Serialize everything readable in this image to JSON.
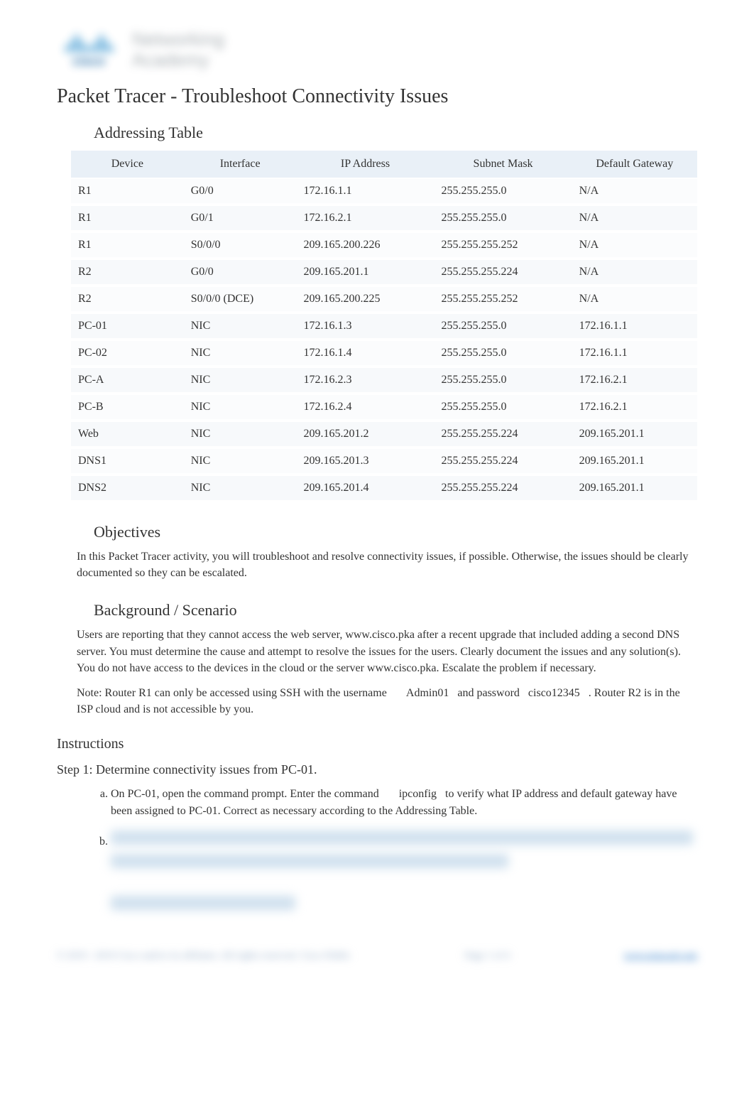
{
  "logo": {
    "brand_top": "Networking",
    "brand_bottom": "Academy",
    "brand_left": "cisco"
  },
  "title": "Packet Tracer - Troubleshoot Connectivity Issues",
  "addressing_heading": "Addressing Table",
  "table": {
    "headers": [
      "Device",
      "Interface",
      "IP Address",
      "Subnet Mask",
      "Default Gateway"
    ],
    "rows": [
      [
        "R1",
        "G0/0",
        "172.16.1.1",
        "255.255.255.0",
        "N/A"
      ],
      [
        "R1",
        "G0/1",
        "172.16.2.1",
        "255.255.255.0",
        "N/A"
      ],
      [
        "R1",
        "S0/0/0",
        "209.165.200.226",
        "255.255.255.252",
        "N/A"
      ],
      [
        "R2",
        "G0/0",
        "209.165.201.1",
        "255.255.255.224",
        "N/A"
      ],
      [
        "R2",
        "S0/0/0 (DCE)",
        "209.165.200.225",
        "255.255.255.252",
        "N/A"
      ],
      [
        "PC-01",
        "NIC",
        "172.16.1.3",
        "255.255.255.0",
        "172.16.1.1"
      ],
      [
        "PC-02",
        "NIC",
        "172.16.1.4",
        "255.255.255.0",
        "172.16.1.1"
      ],
      [
        "PC-A",
        "NIC",
        "172.16.2.3",
        "255.255.255.0",
        "172.16.2.1"
      ],
      [
        "PC-B",
        "NIC",
        "172.16.2.4",
        "255.255.255.0",
        "172.16.2.1"
      ],
      [
        "Web",
        "NIC",
        "209.165.201.2",
        "255.255.255.224",
        "209.165.201.1"
      ],
      [
        "DNS1",
        "NIC",
        "209.165.201.3",
        "255.255.255.224",
        "209.165.201.1"
      ],
      [
        "DNS2",
        "NIC",
        "209.165.201.4",
        "255.255.255.224",
        "209.165.201.1"
      ]
    ]
  },
  "objectives": {
    "heading": "Objectives",
    "text": "In this Packet Tracer activity, you will troubleshoot and resolve connectivity issues, if possible. Otherwise, the issues should be clearly documented so they can be escalated."
  },
  "background": {
    "heading": "Background / Scenario",
    "text": "Users are reporting that they cannot access the web server, www.cisco.pka after a recent upgrade that included adding a second DNS server. You must determine the cause and attempt to resolve the issues for the users. Clearly document the issues and any solution(s). You do not have access to the devices in the cloud or the server www.cisco.pka. Escalate the problem if necessary.",
    "note_prefix": "Note:",
    "note_body_1": "Router R1 can only be accessed using SSH with the username",
    "note_user": "Admin01",
    "note_body_2": "and password",
    "note_pass": "cisco12345",
    "note_body_3": ". Router R2 is in the ISP cloud and is not accessible by you."
  },
  "instructions": {
    "heading": "Instructions",
    "step1_heading": "Step 1: Determine connectivity issues from PC-01.",
    "item_a_1": "On PC-01, open the command prompt. Enter the command",
    "item_a_cmd": "ipconfig",
    "item_a_2": "to verify what IP address and default gateway have been assigned to PC-01. Correct as necessary according to the Addressing Table."
  },
  "footer": {
    "left": "© 2019 - 2019 Cisco and/or its affiliates. All rights reserved. Cisco Public",
    "center": "Page 1 of 4",
    "right": "www.netacad.com"
  }
}
